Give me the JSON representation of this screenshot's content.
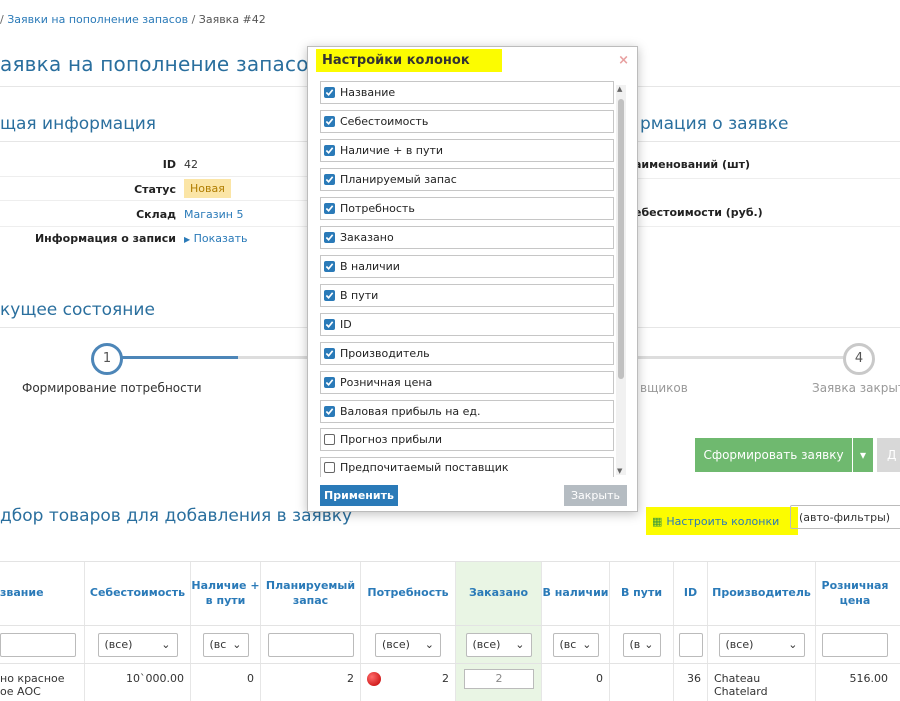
{
  "breadcrumb": {
    "sep1": "/",
    "parent": "Заявки на пополнение запасов",
    "sep2": "/",
    "current": "Заявка #42"
  },
  "page_title": "аявка на пополнение запасов",
  "general": {
    "title": "щая информация",
    "rows": [
      {
        "label": "ID",
        "value": "42"
      },
      {
        "label": "Статус",
        "value": "Новая"
      },
      {
        "label": "Склад",
        "value": "Магазин 5"
      },
      {
        "label": "Информация о записи",
        "value": "Показать"
      }
    ]
  },
  "request_info": {
    "title": "рмация о заявке",
    "rows": [
      "аименований (шт)",
      "ебестоимости (руб.)"
    ]
  },
  "state": {
    "title": "кущее состояние",
    "steps": [
      {
        "num": "1",
        "label": "Формирование потребности"
      },
      {
        "num": "",
        "label": "вщиков"
      },
      {
        "num": "4",
        "label": "Заявка закрыт"
      }
    ]
  },
  "actions": {
    "form_request": "Сформировать заявку",
    "dropdown": "▾",
    "partial": "Д"
  },
  "selection": {
    "title": "дбор товаров для добавления в заявку",
    "configure_columns": "Настроить колонки",
    "auto_filters": "(авто-фильтры)"
  },
  "table": {
    "headers": [
      "звание",
      "Себестоимость",
      "Наличие + в пути",
      "Планируемый запас",
      "Потребность",
      "Заказано",
      "В наличии",
      "В пути",
      "ID",
      "Производитель",
      "Розничная цена"
    ],
    "filters": [
      "",
      "(все)",
      "(вс",
      "",
      "(все)",
      "(все)",
      "(вс",
      "(в",
      "",
      "(все)",
      ""
    ],
    "row": {
      "name": "но красное\nое АОС",
      "cost": "10`000.00",
      "stock_transit": "0",
      "planned": "2",
      "need": "2",
      "ordered": "2",
      "in_stock": "0",
      "in_transit": "",
      "id": "36",
      "maker": "Chateau\nChatelard",
      "price": "516.00"
    }
  },
  "modal": {
    "title": "Настройки колонок",
    "close": "×",
    "items": [
      {
        "label": "Название",
        "checked": true
      },
      {
        "label": "Себестоимость",
        "checked": true
      },
      {
        "label": "Наличие + в пути",
        "checked": true
      },
      {
        "label": "Планируемый запас",
        "checked": true
      },
      {
        "label": "Потребность",
        "checked": true
      },
      {
        "label": "Заказано",
        "checked": true
      },
      {
        "label": "В наличии",
        "checked": true
      },
      {
        "label": "В пути",
        "checked": true
      },
      {
        "label": "ID",
        "checked": true
      },
      {
        "label": "Производитель",
        "checked": true
      },
      {
        "label": "Розничная цена",
        "checked": true
      },
      {
        "label": "Валовая прибыль на ед.",
        "checked": true
      },
      {
        "label": "Прогноз прибыли",
        "checked": false
      },
      {
        "label": "Предпочитаемый поставщик",
        "checked": false
      }
    ],
    "apply": "Применить",
    "close_button": "Закрыть"
  },
  "colors": {
    "accent": "#2a7ab8",
    "green": "#6fb96f",
    "highlight": "#fcfc00"
  }
}
